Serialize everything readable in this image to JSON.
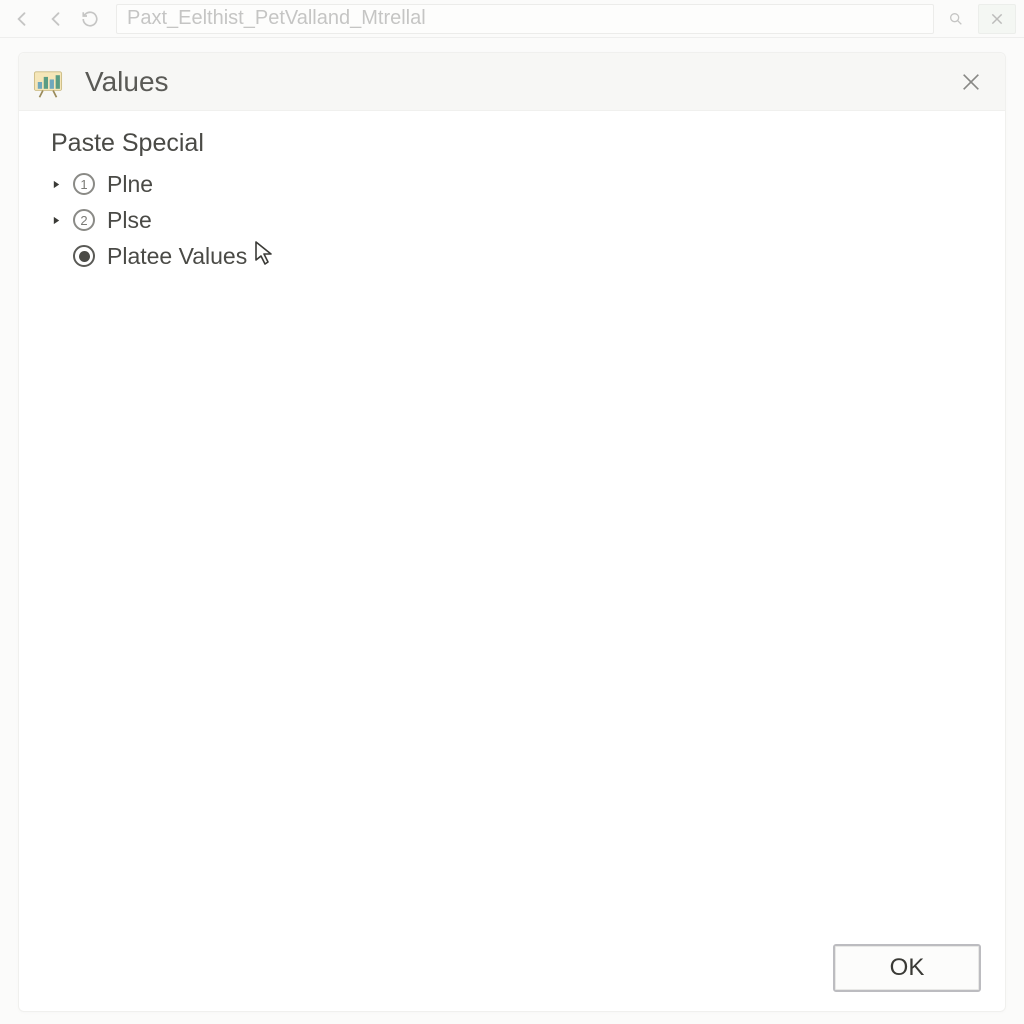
{
  "topbar": {
    "address_text": "Paxt_Eelthist_PetValland_Mtrellal"
  },
  "dialog": {
    "title": "Values",
    "section_title": "Paste Special",
    "options": [
      {
        "badge": "1",
        "label": "Plne",
        "expandable": true,
        "selected": false
      },
      {
        "badge": "2",
        "label": "Plse",
        "expandable": true,
        "selected": false
      },
      {
        "badge": "",
        "label": "Platee Values",
        "expandable": false,
        "selected": true
      }
    ],
    "ok_label": "OK"
  }
}
